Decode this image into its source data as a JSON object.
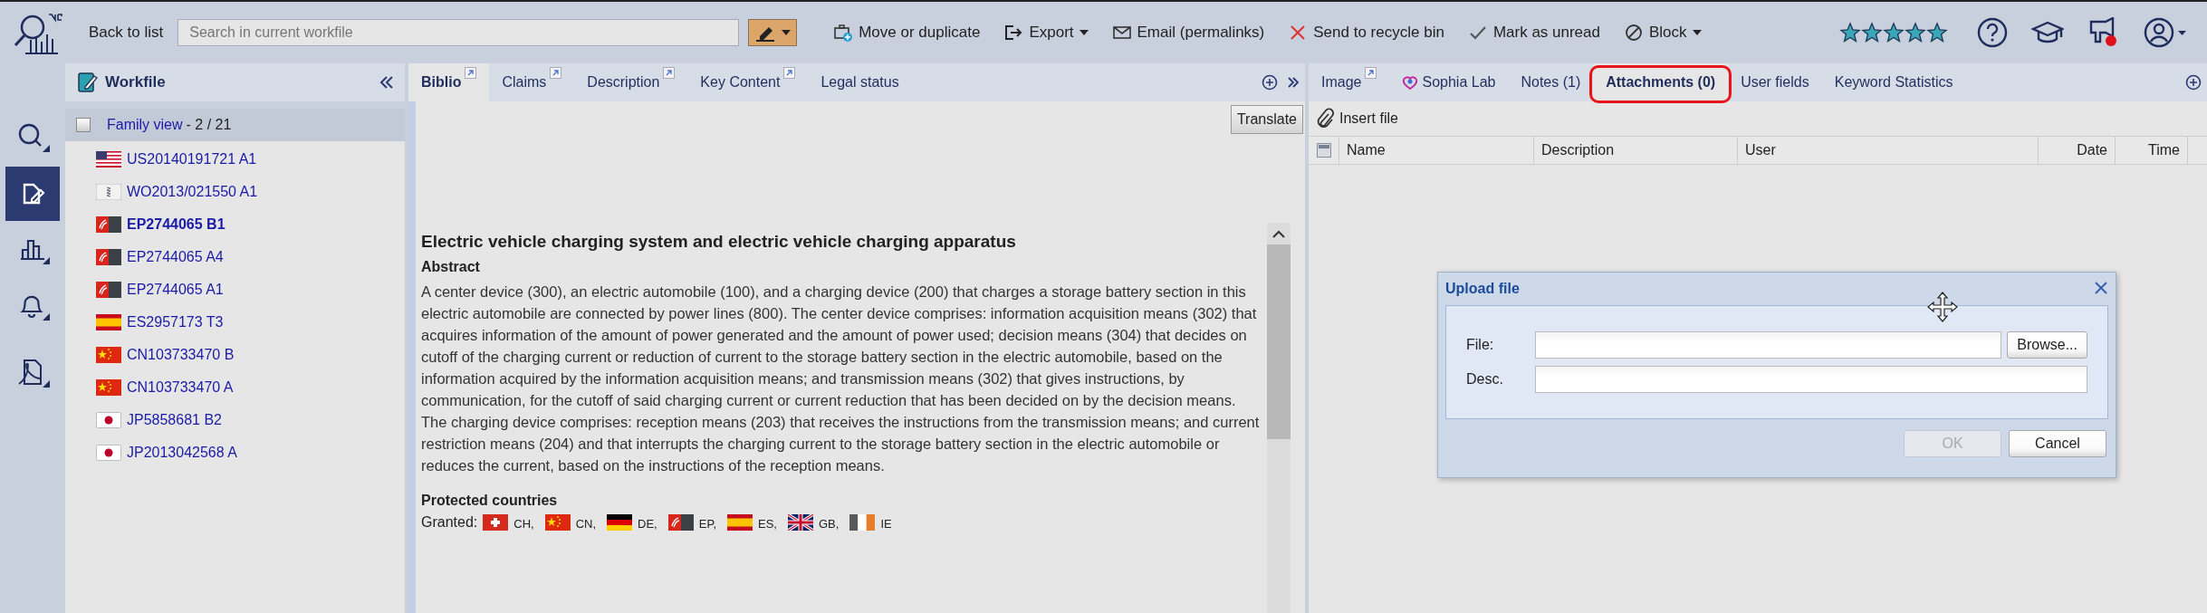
{
  "toolbar": {
    "back": "Back to list",
    "search_placeholder": "Search in current workfile",
    "actions": [
      {
        "label": "Move or duplicate",
        "kind": "move",
        "dropdown": false
      },
      {
        "label": "Export",
        "kind": "export",
        "dropdown": true
      },
      {
        "label": "Email (permalinks)",
        "kind": "email",
        "dropdown": false
      },
      {
        "label": "Send to recycle bin",
        "kind": "delete",
        "dropdown": false
      },
      {
        "label": "Mark as unread",
        "kind": "check",
        "dropdown": false
      },
      {
        "label": "Block",
        "kind": "block",
        "dropdown": true
      }
    ],
    "rating": {
      "stars": 5
    }
  },
  "rail": [
    {
      "kind": "search",
      "selected": false
    },
    {
      "kind": "edit",
      "selected": true
    },
    {
      "kind": "chart",
      "selected": false
    },
    {
      "kind": "bell",
      "selected": false
    },
    {
      "kind": "pdf",
      "selected": false
    }
  ],
  "workfile": {
    "title": "Workfile",
    "family_view": {
      "label": "Family view",
      "count": "- 2 / 21",
      "checked": false
    },
    "items": [
      {
        "number": "US20140191721 A1",
        "kind": "us",
        "selected": false
      },
      {
        "number": "WO2013/021550 A1",
        "kind": "wo",
        "selected": false
      },
      {
        "number": "EP2744065 B1",
        "kind": "ep",
        "selected": true
      },
      {
        "number": "EP2744065 A4",
        "kind": "ep",
        "selected": false
      },
      {
        "number": "EP2744065 A1",
        "kind": "ep",
        "selected": false
      },
      {
        "number": "ES2957173 T3",
        "kind": "es",
        "selected": false
      },
      {
        "number": "CN103733470 B",
        "kind": "cn",
        "selected": false
      },
      {
        "number": "CN103733470 A",
        "kind": "cn",
        "selected": false
      },
      {
        "number": "JP5858681 B2",
        "kind": "jp",
        "selected": false
      },
      {
        "number": "JP2013042568 A",
        "kind": "jp",
        "selected": false
      }
    ]
  },
  "document_tabs": [
    {
      "label": "Biblio",
      "external": true,
      "selected": true
    },
    {
      "label": "Claims",
      "external": true,
      "selected": false
    },
    {
      "label": "Description",
      "external": true,
      "selected": false
    },
    {
      "label": "Key Content",
      "external": true,
      "selected": false
    },
    {
      "label": "Legal status",
      "external": false,
      "selected": false
    }
  ],
  "translate": "Translate",
  "biblio": {
    "title": "Electric vehicle charging system and electric vehicle charging apparatus",
    "abstract_heading": "Abstract",
    "abstract": "A center device (300), an electric automobile (100), and a charging device (200) that charges a storage battery section in this electric automobile are connected by power lines (800). The center device comprises: information acquisition means (302) that acquires information of the amount of power generated and the amount of power used; decision means (304) that decides on cutoff of the charging current or reduction of current to the storage battery section in the electric automobile, based on the information acquired by the information acquisition means; and transmission means (302) that gives instructions, by communication, for the cutoff of said charging current or current reduction that has been decided on by the decision means. The charging device comprises: reception means (203) that receives the instructions from the transmission means; and current restriction means (204) and that interrupts the charging current to the storage battery section in the electric automobile or reduces the current, based on the instructions of the reception means.",
    "countries_heading": "Protected countries",
    "granted_label": "Granted:",
    "granted": [
      {
        "code": "CH,",
        "kind": "ch"
      },
      {
        "code": "CN,",
        "kind": "cn"
      },
      {
        "code": "DE,",
        "kind": "de"
      },
      {
        "code": "EP,",
        "kind": "ep"
      },
      {
        "code": "ES,",
        "kind": "es"
      },
      {
        "code": "GB,",
        "kind": "gb"
      },
      {
        "code": "IE",
        "kind": "ie"
      }
    ]
  },
  "side_tabs": [
    {
      "label": "Image",
      "kind": "external",
      "selected": false,
      "highlighted": false
    },
    {
      "label": "Sophia Lab",
      "kind": "lab",
      "selected": false,
      "highlighted": false
    },
    {
      "label": "Notes (1)",
      "kind": "plain",
      "selected": false,
      "highlighted": false
    },
    {
      "label": "Attachments (0)",
      "kind": "plain",
      "selected": true,
      "highlighted": true
    },
    {
      "label": "User fields",
      "kind": "plain",
      "selected": false,
      "highlighted": false
    },
    {
      "label": "Keyword Statistics",
      "kind": "plain",
      "selected": false,
      "highlighted": false
    }
  ],
  "insert_file": "Insert file",
  "attachments_table": {
    "columns": [
      "Name",
      "Description",
      "User",
      "Date",
      "Time"
    ]
  },
  "upload_dialog": {
    "title": "Upload file",
    "fields": [
      {
        "label": "File:",
        "kind": "file",
        "button": "Browse..."
      },
      {
        "label": "Desc.",
        "kind": "text"
      }
    ],
    "buttons": [
      {
        "label": "OK",
        "disabled": true
      },
      {
        "label": "Cancel",
        "disabled": false
      }
    ]
  }
}
